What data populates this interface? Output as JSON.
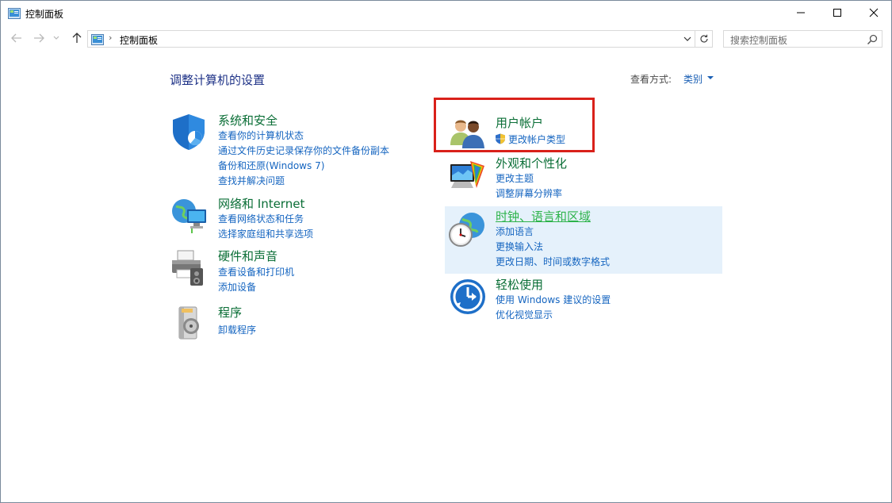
{
  "window": {
    "title": "控制面板"
  },
  "address": {
    "path_label": "控制面板",
    "separator": "›"
  },
  "search": {
    "placeholder": "搜索控制面板"
  },
  "main": {
    "title": "调整计算机的设置",
    "view_label": "查看方式:",
    "view_value": "类别"
  },
  "categories_left": [
    {
      "name": "系统和安全",
      "links": [
        "查看你的计算机状态",
        "通过文件历史记录保存你的文件备份副本",
        "备份和还原(Windows 7)",
        "查找并解决问题"
      ]
    },
    {
      "name": "网络和 Internet",
      "links": [
        "查看网络状态和任务",
        "选择家庭组和共享选项"
      ]
    },
    {
      "name": "硬件和声音",
      "links": [
        "查看设备和打印机",
        "添加设备"
      ]
    },
    {
      "name": "程序",
      "links": [
        "卸载程序"
      ]
    }
  ],
  "categories_right": [
    {
      "name": "用户帐户",
      "links": [
        "更改帐户类型"
      ]
    },
    {
      "name": "外观和个性化",
      "links": [
        "更改主题",
        "调整屏幕分辨率"
      ]
    },
    {
      "name": "时钟、语言和区域",
      "links": [
        "添加语言",
        "更换输入法",
        "更改日期、时间或数字格式"
      ]
    },
    {
      "name": "轻松使用",
      "links": [
        "使用 Windows 建议的设置",
        "优化视觉显示"
      ]
    }
  ],
  "colors": {
    "category_heading": "#0a6e36",
    "link": "#1565c0",
    "highlight_border": "#d9211a",
    "hover_background": "#e5f1fb"
  }
}
